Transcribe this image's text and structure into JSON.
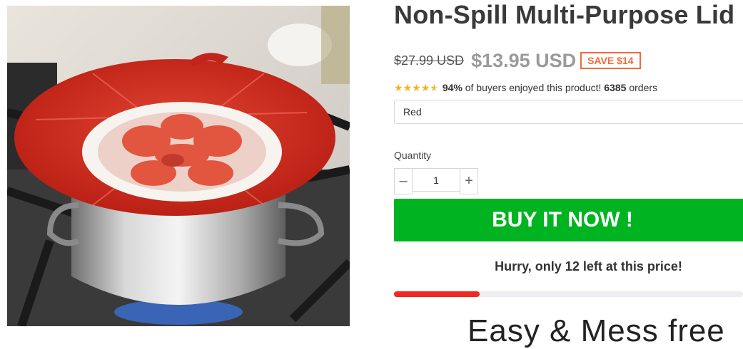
{
  "product": {
    "title": "Non-Spill Multi-Purpose Lid",
    "image_alt": "Red silicone lid on a boiling pot"
  },
  "pricing": {
    "old_price": "$27.99 USD",
    "new_price": "$13.95 USD",
    "save_badge": "SAVE $14"
  },
  "rating": {
    "stars": 4.5,
    "percent": "94%",
    "text": "of buyers enjoyed this product!",
    "orders_count": "6385",
    "orders_label": "orders"
  },
  "variant": {
    "selected": "Red"
  },
  "quantity": {
    "label": "Quantity",
    "value": "1",
    "minus": "–",
    "plus": "+"
  },
  "cta": {
    "buy_label": "BUY IT NOW !"
  },
  "stock": {
    "hurry_text": "Hurry, only 12 left at this price!",
    "progress_fraction": 0.245
  },
  "promo": {
    "heading": "Easy & Mess free"
  },
  "colors": {
    "buy_green": "#00b421",
    "badge_orange": "#f26b3a",
    "progress_red": "#ef2b1f",
    "star_gold": "#f3b51b"
  }
}
